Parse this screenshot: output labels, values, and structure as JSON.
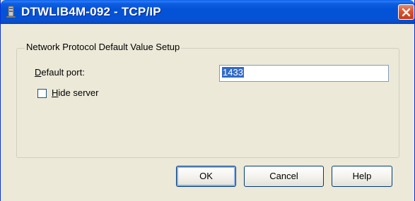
{
  "window": {
    "title": "DTWLIB4M-092 - TCP/IP",
    "title_icon": "server-config-icon",
    "close_icon": "close-icon"
  },
  "group": {
    "label": "Network Protocol Default Value Setup"
  },
  "port": {
    "label_mnemonic": "D",
    "label_rest": "efault port:",
    "value": "1433"
  },
  "hide_server": {
    "label_mnemonic": "H",
    "label_rest": "ide server",
    "checked": false
  },
  "buttons": {
    "ok": "OK",
    "cancel": "Cancel",
    "help": "Help"
  }
}
